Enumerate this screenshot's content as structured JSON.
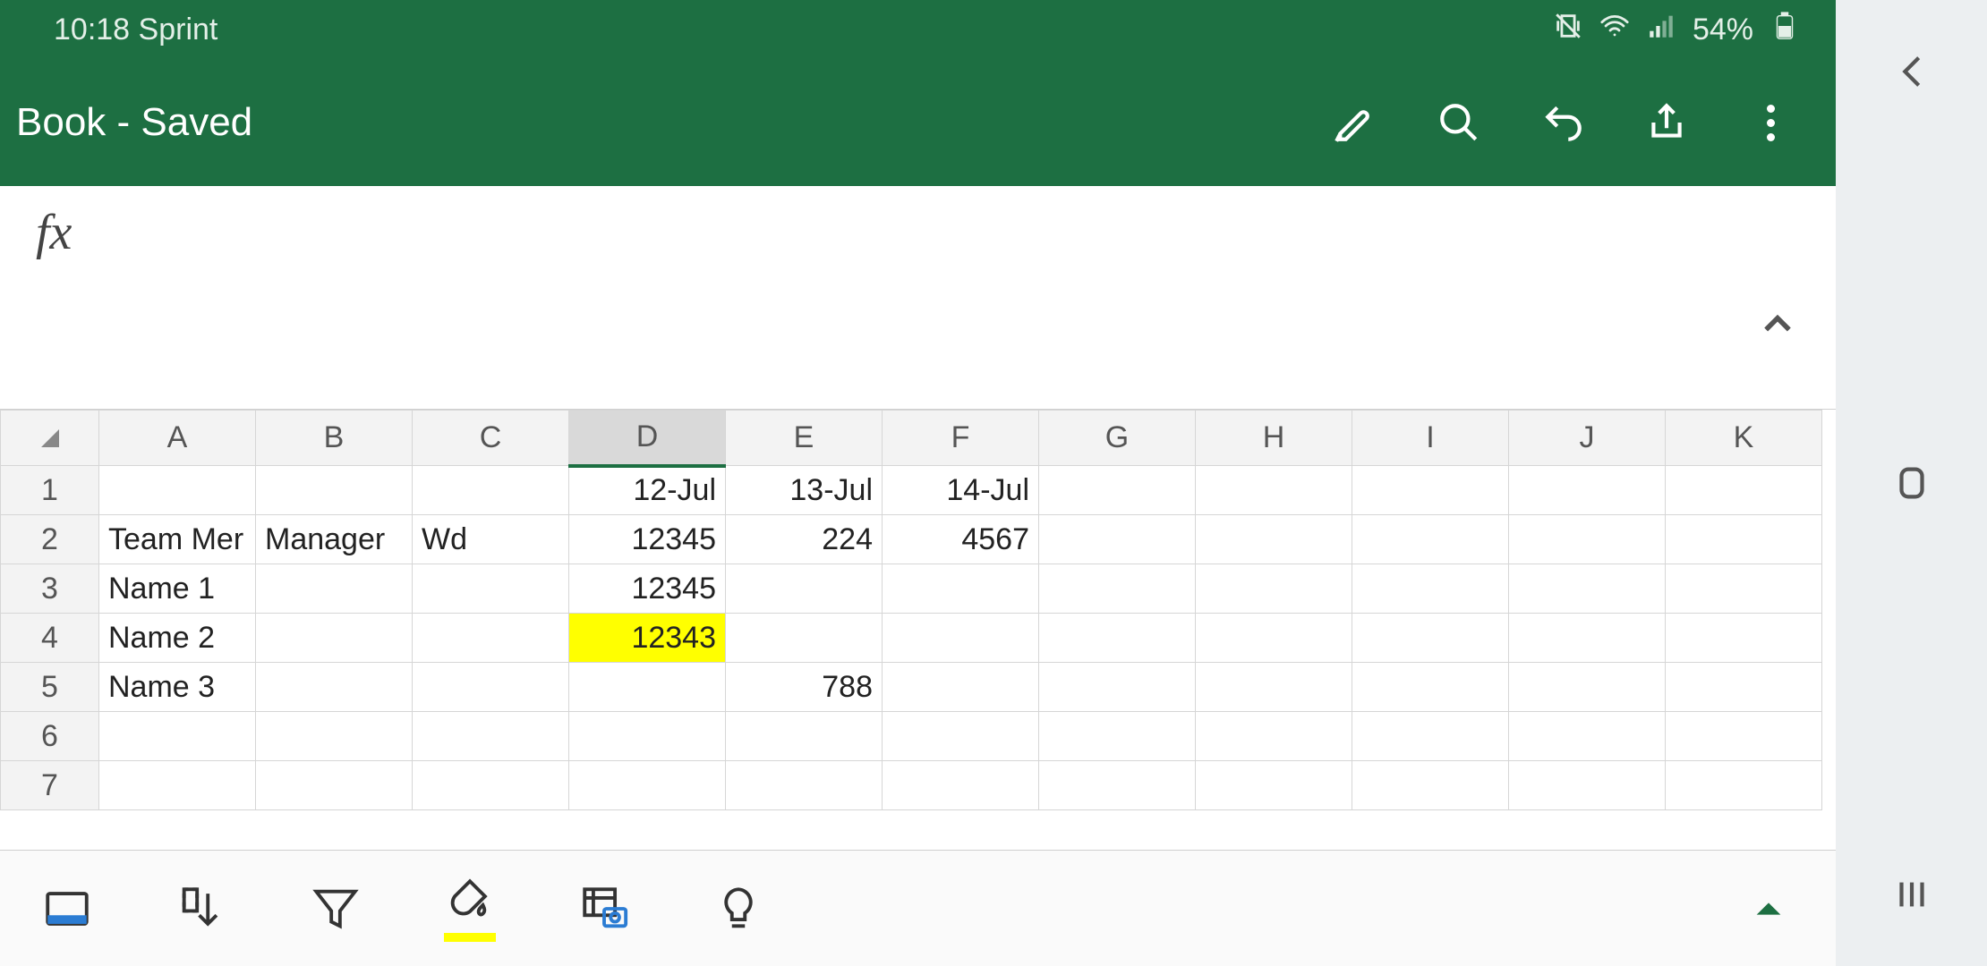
{
  "status": {
    "time": "10:18",
    "carrier": "Sprint",
    "battery": "54%"
  },
  "title": "Book - Saved",
  "formula_value": "",
  "columns": [
    "A",
    "B",
    "C",
    "D",
    "E",
    "F",
    "G",
    "H",
    "I",
    "J",
    "K"
  ],
  "selected_column_index": 3,
  "rows": [
    {
      "n": "1",
      "cells": {
        "D": "12-Jul",
        "E": "13-Jul",
        "F": "14-Jul"
      }
    },
    {
      "n": "2",
      "cells": {
        "A": "Team Mer",
        "B": "Manager",
        "C": "Wd",
        "D": "12345",
        "E": "224",
        "F": "4567"
      }
    },
    {
      "n": "3",
      "cells": {
        "A": "Name 1",
        "D": "12345"
      }
    },
    {
      "n": "4",
      "cells": {
        "A": "Name 2",
        "D": "12343"
      },
      "highlight": [
        "D"
      ]
    },
    {
      "n": "5",
      "cells": {
        "A": "Name 3",
        "E": "788"
      }
    },
    {
      "n": "6",
      "cells": {}
    },
    {
      "n": "7",
      "cells": {}
    }
  ],
  "chart_data": {
    "type": "table",
    "headers": [
      "",
      "",
      "",
      "12-Jul",
      "13-Jul",
      "14-Jul"
    ],
    "rows": [
      [
        "Team Mer",
        "Manager",
        "Wd",
        12345,
        224,
        4567
      ],
      [
        "Name 1",
        "",
        "",
        12345,
        "",
        ""
      ],
      [
        "Name 2",
        "",
        "",
        12343,
        "",
        ""
      ],
      [
        "Name 3",
        "",
        "",
        "",
        788,
        ""
      ]
    ]
  }
}
